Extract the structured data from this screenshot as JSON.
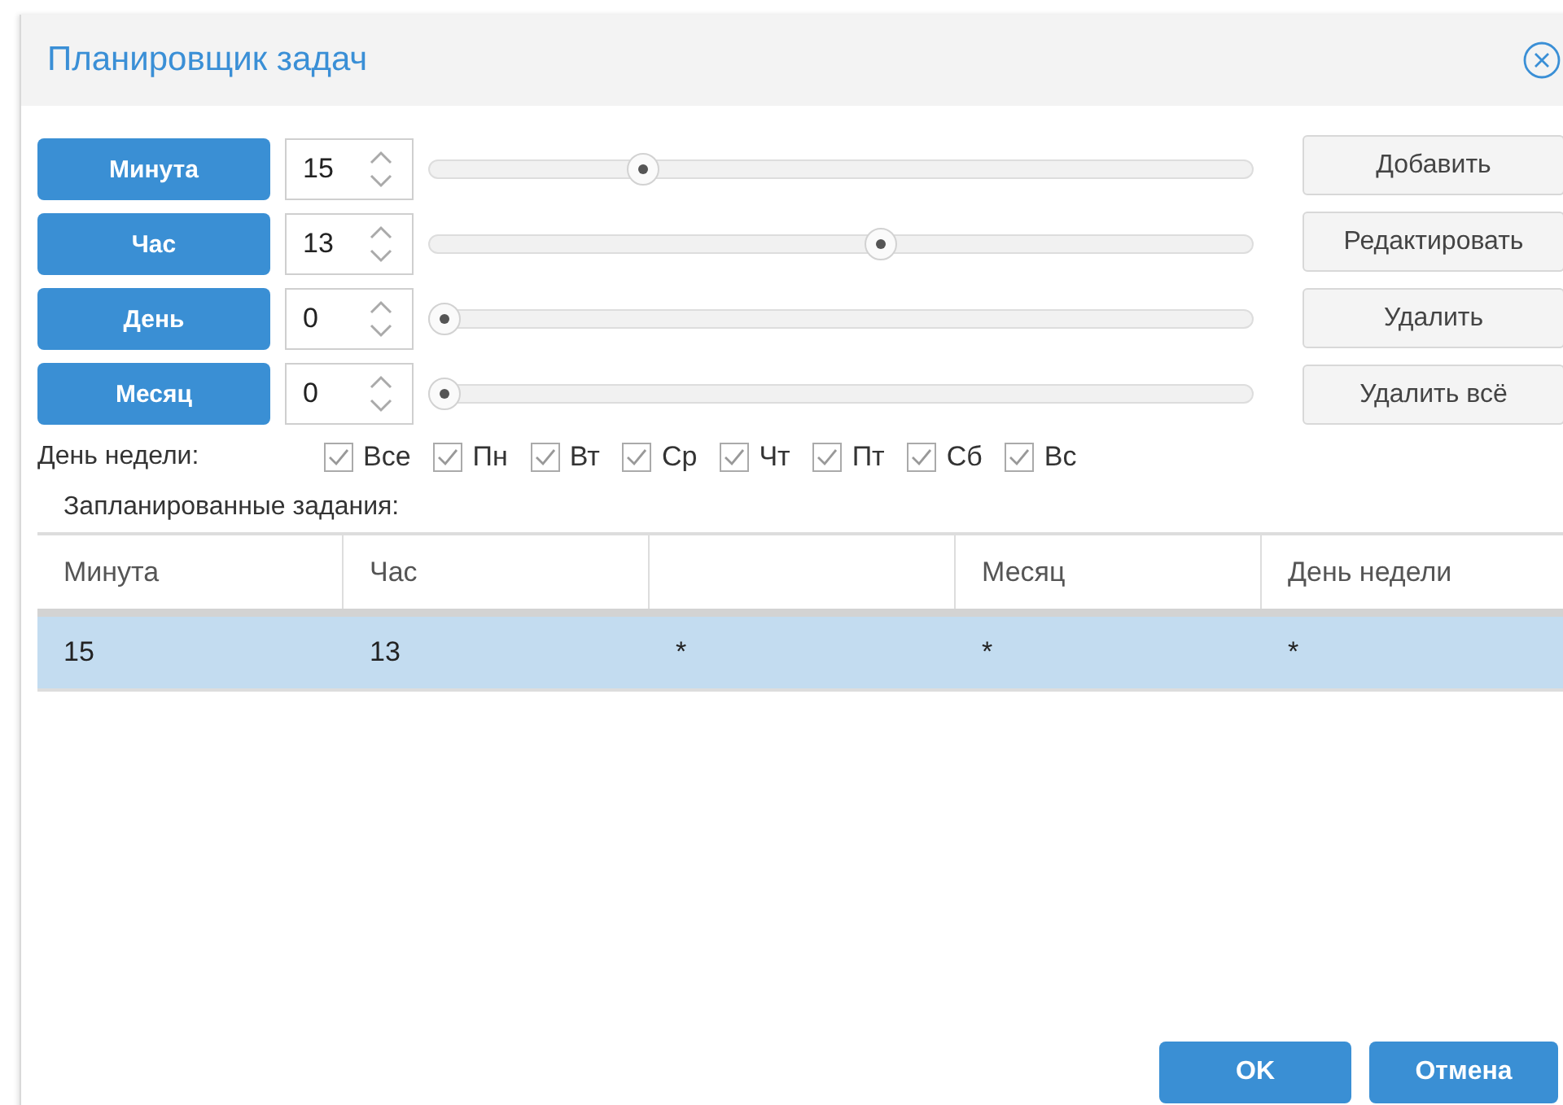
{
  "window": {
    "title": "Планировщик задач"
  },
  "fields": [
    {
      "label": "Минута",
      "value": "15",
      "level": 0.25
    },
    {
      "label": "Час",
      "value": "13",
      "level": 0.55
    },
    {
      "label": "День",
      "value": "0",
      "level": 0
    },
    {
      "label": "Месяц",
      "value": "0",
      "level": 0
    }
  ],
  "actions": [
    "Добавить",
    "Редактировать",
    "Удалить",
    "Удалить всё"
  ],
  "weekdays": {
    "label": "День недели:",
    "items": [
      {
        "label": "Все",
        "checked": true
      },
      {
        "label": "Пн",
        "checked": true
      },
      {
        "label": "Вт",
        "checked": true
      },
      {
        "label": "Ср",
        "checked": true
      },
      {
        "label": "Чт",
        "checked": true
      },
      {
        "label": "Пт",
        "checked": true
      },
      {
        "label": "Сб",
        "checked": true
      },
      {
        "label": "Вс",
        "checked": true
      }
    ]
  },
  "table": {
    "title": "Запланированные задания:",
    "columns": [
      {
        "label": "Минута"
      },
      {
        "label": "Час"
      },
      {},
      {
        "label": "Месяц"
      },
      {
        "label": "День недели"
      }
    ],
    "rows": [
      {
        "cells": [
          "15",
          "13",
          "*",
          "*",
          "*"
        ],
        "selected": true
      }
    ]
  },
  "buttons": [
    "OK",
    "Отмена"
  ]
}
